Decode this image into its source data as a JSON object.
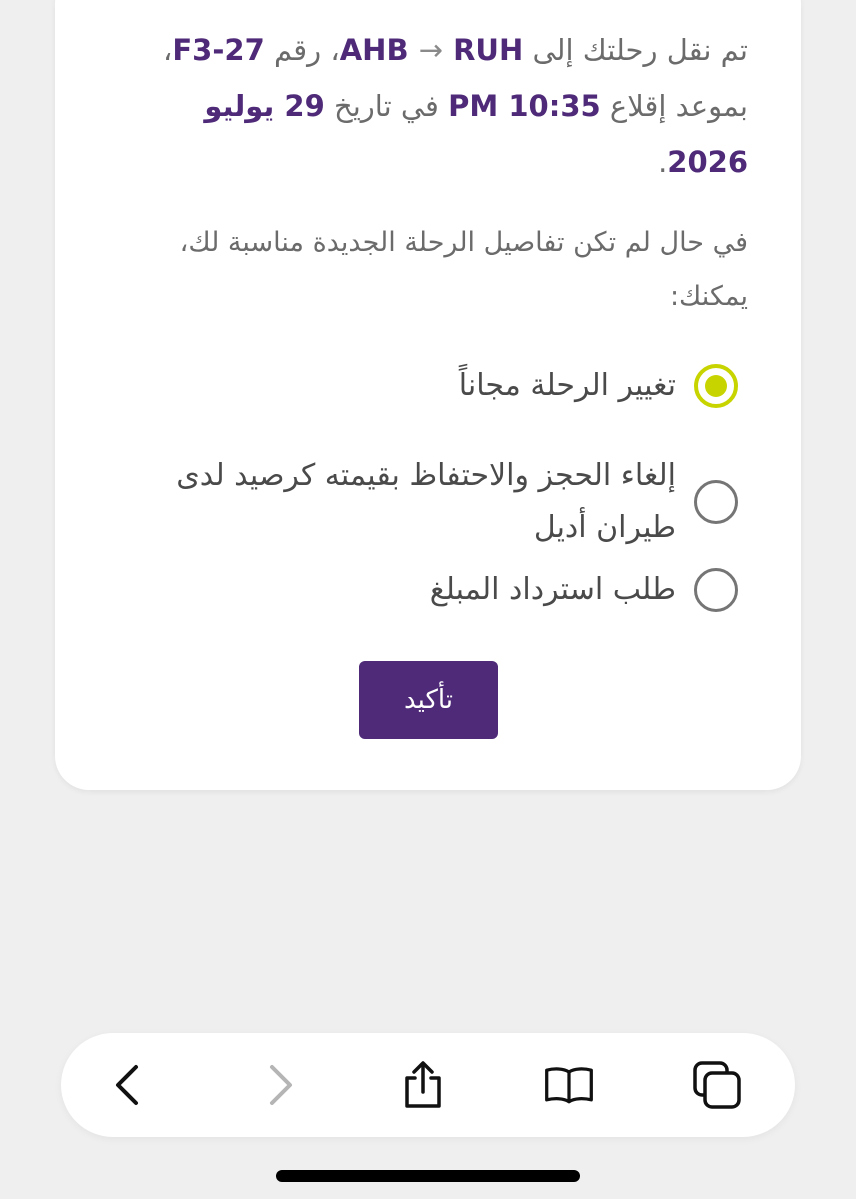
{
  "notice": {
    "part1": "تم نقل رحلتك إلى",
    "route_from": "AHB",
    "route_arrow": "→",
    "route_to": "RUH",
    "part2": "، رقم",
    "flight_number": "F3-27",
    "part3": "، بموعد إقلاع",
    "departure_time": "PM 10:35",
    "part4": "في تاريخ",
    "departure_date": "29 يوليو 2026",
    "part5": "."
  },
  "options_intro": "في حال لم تكن تفاصيل الرحلة الجديدة مناسبة لك، يمكنك:",
  "options": [
    {
      "label": "تغيير الرحلة مجاناً",
      "selected": true
    },
    {
      "label": "إلغاء الحجز والاحتفاظ بقيمته كرصيد لدى طيران أديل",
      "selected": false
    },
    {
      "label": "طلب استرداد المبلغ",
      "selected": false
    }
  ],
  "confirm_label": "تأكيد",
  "toolbar": {
    "back_icon": "chevron-left-icon",
    "forward_icon": "chevron-right-icon",
    "share_icon": "share-icon",
    "bookmarks_icon": "book-icon",
    "tabs_icon": "tabs-icon"
  },
  "colors": {
    "brand_purple": "#4e2a78",
    "selected_radio": "#c8d400"
  }
}
